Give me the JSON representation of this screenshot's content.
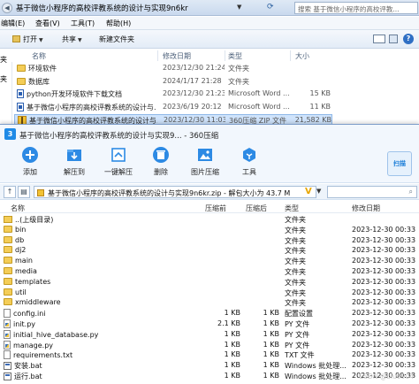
{
  "explorer": {
    "title": "基于微信小程序的高校评教系统的设计与实现9n6kr",
    "search_placeholder": "搜索 基于微信小程序的高校评教...",
    "menu": [
      "编辑(E)",
      "查看(V)",
      "工具(T)",
      "帮助(H)"
    ],
    "toolbar": {
      "open": "打开",
      "share": "共享",
      "new_folder": "新建文件夹"
    },
    "columns": [
      "名称",
      "修改日期",
      "类型",
      "大小"
    ],
    "sidebar": [
      "夹",
      "夹",
      "",
      "",
      ""
    ],
    "files": [
      {
        "name": "环境软件",
        "date": "2023/12/30 21:24",
        "type": "文件夹",
        "size": "",
        "icon": "folder"
      },
      {
        "name": "数据库",
        "date": "2024/1/17 21:28",
        "type": "文件夹",
        "size": "",
        "icon": "folder"
      },
      {
        "name": "python开发环境软件下载文档",
        "date": "2023/12/30 21:23",
        "type": "Microsoft Word ...",
        "size": "15 KB",
        "icon": "doc"
      },
      {
        "name": "基于微信小程序的高校评教系统的设计与...",
        "date": "2023/6/19 20:12",
        "type": "Microsoft Word ...",
        "size": "11 KB",
        "icon": "doc"
      },
      {
        "name": "基于微信小程序的高校评教系统的设计与...",
        "date": "2023/12/30 11:03",
        "type": "360压缩 ZIP 文件",
        "size": "21,582 KB",
        "icon": "zip",
        "selected": true
      }
    ]
  },
  "zip": {
    "title": "基于微信小程序的高校评教系统的设计与实现9... - 360压缩",
    "tools": [
      {
        "label": "添加",
        "icon": "plus-icon"
      },
      {
        "label": "解压到",
        "icon": "extract-icon"
      },
      {
        "label": "一键解压",
        "icon": "one-click-extract-icon"
      },
      {
        "label": "删除",
        "icon": "trash-icon"
      },
      {
        "label": "图片压缩",
        "icon": "image-compress-icon"
      },
      {
        "label": "工具",
        "icon": "tools-icon"
      }
    ],
    "scan_label": "扫描",
    "path": "基于微信小程序的高校评教系统的设计与实现9n6kr.zip - 解包大小为 43.7 M",
    "columns": [
      "名称",
      "压缩前",
      "压缩后",
      "类型",
      "修改日期"
    ],
    "files": [
      {
        "name": "..(上级目录)",
        "before": "",
        "after": "",
        "type": "文件夹",
        "date": "",
        "icon": "up"
      },
      {
        "name": "bin",
        "before": "",
        "after": "",
        "type": "文件夹",
        "date": "2023-12-30 00:33",
        "icon": "folder"
      },
      {
        "name": "db",
        "before": "",
        "after": "",
        "type": "文件夹",
        "date": "2023-12-30 00:33",
        "icon": "folder"
      },
      {
        "name": "dj2",
        "before": "",
        "after": "",
        "type": "文件夹",
        "date": "2023-12-30 00:33",
        "icon": "folder"
      },
      {
        "name": "main",
        "before": "",
        "after": "",
        "type": "文件夹",
        "date": "2023-12-30 00:33",
        "icon": "folder"
      },
      {
        "name": "media",
        "before": "",
        "after": "",
        "type": "文件夹",
        "date": "2023-12-30 00:33",
        "icon": "folder"
      },
      {
        "name": "templates",
        "before": "",
        "after": "",
        "type": "文件夹",
        "date": "2023-12-30 00:33",
        "icon": "folder"
      },
      {
        "name": "util",
        "before": "",
        "after": "",
        "type": "文件夹",
        "date": "2023-12-30 00:33",
        "icon": "folder"
      },
      {
        "name": "xmiddleware",
        "before": "",
        "after": "",
        "type": "文件夹",
        "date": "2023-12-30 00:33",
        "icon": "folder"
      },
      {
        "name": "config.ini",
        "before": "1 KB",
        "after": "1 KB",
        "type": "配置设置",
        "date": "2023-12-30 00:33",
        "icon": "file"
      },
      {
        "name": "init.py",
        "before": "2.1 KB",
        "after": "1 KB",
        "type": "PY 文件",
        "date": "2023-12-30 00:33",
        "icon": "py"
      },
      {
        "name": "initial_hive_database.py",
        "before": "1 KB",
        "after": "1 KB",
        "type": "PY 文件",
        "date": "2023-12-30 00:33",
        "icon": "py"
      },
      {
        "name": "manage.py",
        "before": "1 KB",
        "after": "1 KB",
        "type": "PY 文件",
        "date": "2023-12-30 00:33",
        "icon": "py"
      },
      {
        "name": "requirements.txt",
        "before": "1 KB",
        "after": "1 KB",
        "type": "TXT 文件",
        "date": "2023-12-30 00:33",
        "icon": "file"
      },
      {
        "name": "安装.bat",
        "before": "1 KB",
        "after": "1 KB",
        "type": "Windows 批处理...",
        "date": "2023-12-30 00:33",
        "icon": "bat"
      },
      {
        "name": "运行.bat",
        "before": "1 KB",
        "after": "1 KB",
        "type": "Windows 批处理...",
        "date": "2023-12-30 00:33",
        "icon": "bat"
      }
    ],
    "watermark": "CSDN @biu0904"
  }
}
